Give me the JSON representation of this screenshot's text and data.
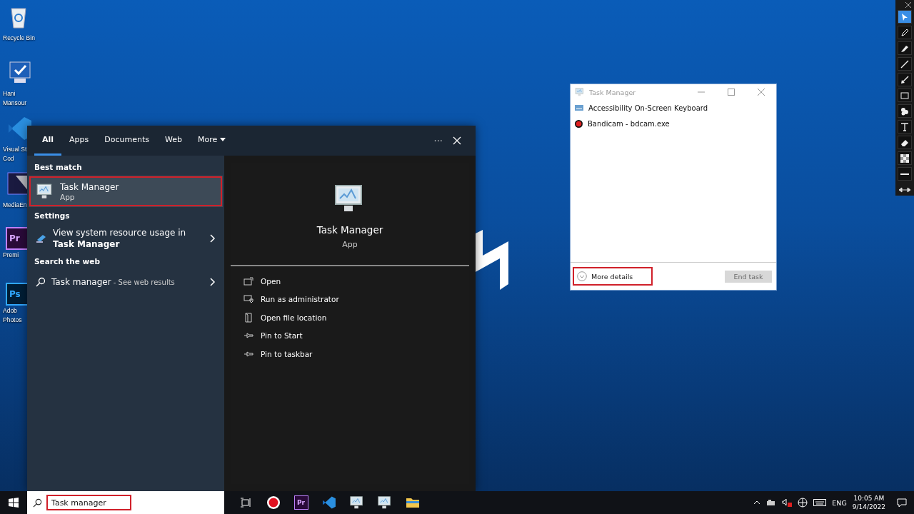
{
  "desktop_icons": [
    {
      "kind": "recycle",
      "lines": [
        "Recycle Bin"
      ]
    },
    {
      "kind": "computer",
      "lines": [
        "Hani",
        "Mansour"
      ]
    },
    {
      "kind": "vscode",
      "lines": [
        "Visual St",
        "Cod"
      ]
    },
    {
      "kind": "media",
      "lines": [
        "MediaEn"
      ]
    },
    {
      "kind": "premiere",
      "mark": "Pr",
      "lines": [
        "Premi"
      ]
    },
    {
      "kind": "photoshop",
      "mark": "Ps",
      "lines": [
        "Adob",
        "Photos"
      ]
    }
  ],
  "search_panel": {
    "tabs": [
      {
        "label": "All",
        "selected": true,
        "dropdown": false
      },
      {
        "label": "Apps",
        "selected": false,
        "dropdown": false
      },
      {
        "label": "Documents",
        "selected": false,
        "dropdown": false
      },
      {
        "label": "Web",
        "selected": false,
        "dropdown": false
      },
      {
        "label": "More",
        "selected": false,
        "dropdown": true
      }
    ],
    "menu_glyph": "···",
    "sections": [
      {
        "heading": "Best match",
        "items": [
          {
            "kind": "app",
            "title": "Task Manager",
            "subtitle": "App",
            "selected": true,
            "annotated": true
          }
        ]
      },
      {
        "heading": "Settings",
        "items": [
          {
            "kind": "setting",
            "title": "View system resource usage in **Task Manager**",
            "selected": false,
            "annotated": false
          }
        ]
      },
      {
        "heading": "Search the web",
        "items": [
          {
            "kind": "web",
            "title": "Task manager",
            "hint": " - See web results",
            "selected": false,
            "annotated": false
          }
        ]
      }
    ],
    "preview": {
      "title": "Task Manager",
      "subtitle": "App",
      "actions": [
        {
          "kind": "open",
          "label": "Open"
        },
        {
          "kind": "admin",
          "label": "Run as administrator"
        },
        {
          "kind": "folder",
          "label": "Open file location"
        },
        {
          "kind": "pin",
          "label": "Pin to Start"
        },
        {
          "kind": "pin",
          "label": "Pin to taskbar"
        }
      ]
    }
  },
  "task_manager": {
    "title": "Task Manager",
    "apps": [
      {
        "kind": "keyboard",
        "name": "Accessibility On-Screen Keyboard"
      },
      {
        "kind": "record",
        "name": "Bandicam - bdcam.exe"
      }
    ],
    "more_details": {
      "label": "More details",
      "annotated": true
    },
    "end_task": {
      "label": "End task",
      "disabled": true
    }
  },
  "draw_toolbar": {
    "tools": [
      {
        "kind": "pointer",
        "selected": true
      },
      {
        "kind": "pencil",
        "selected": false
      },
      {
        "kind": "highlighter",
        "selected": false
      },
      {
        "kind": "line",
        "selected": false
      },
      {
        "kind": "arrow",
        "selected": false
      },
      {
        "kind": "rectangle",
        "selected": false
      },
      {
        "kind": "stamp",
        "selected": false
      },
      {
        "kind": "text",
        "selected": false
      },
      {
        "kind": "eraser",
        "selected": false
      },
      {
        "kind": "fill",
        "selected": false
      },
      {
        "kind": "width",
        "selected": false
      }
    ]
  },
  "taskbar": {
    "search": {
      "value": "Task manager",
      "annotated": true
    },
    "apps": [
      {
        "kind": "taskview"
      },
      {
        "kind": "record"
      },
      {
        "kind": "premiere",
        "mark": "Pr"
      },
      {
        "kind": "vscode"
      },
      {
        "kind": "network"
      },
      {
        "kind": "taskmgr"
      },
      {
        "kind": "folder"
      }
    ],
    "language": "ENG",
    "time": "10:05 AM",
    "date": "9/14/2022"
  }
}
